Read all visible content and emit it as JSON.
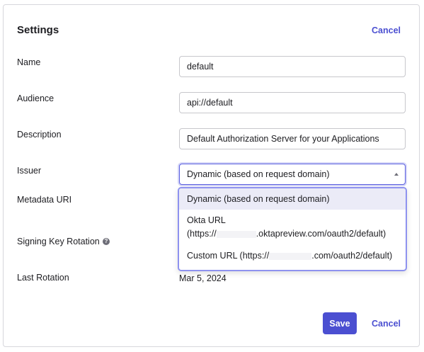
{
  "header": {
    "title": "Settings",
    "cancel_label": "Cancel"
  },
  "fields": {
    "name_label": "Name",
    "name_value": "default",
    "audience_label": "Audience",
    "audience_value": "api://default",
    "description_label": "Description",
    "description_value": "Default Authorization Server for your Applications",
    "issuer_label": "Issuer",
    "issuer_value": "Dynamic (based on request domain)",
    "metadata_label": "Metadata URI",
    "signing_label": "Signing Key Rotation",
    "last_rotation_label": "Last Rotation",
    "last_rotation_value": "Mar 5, 2024"
  },
  "issuer_options": [
    {
      "line1": "Dynamic (based on request domain)"
    },
    {
      "line1": "Okta URL",
      "line2_prefix": "(https://",
      "line2_suffix": ".oktapreview.com/oauth2/default)"
    },
    {
      "line1_prefix": "Custom URL (https://",
      "line1_suffix": ".com/oauth2/default)"
    }
  ],
  "footer": {
    "save_label": "Save",
    "cancel_label": "Cancel"
  },
  "colors": {
    "accent": "#4b4fd1",
    "focus_border": "#8e92ef",
    "highlight": "#ebebf7"
  },
  "icons": {
    "info": "info-icon",
    "caret": "caret-up-icon"
  }
}
